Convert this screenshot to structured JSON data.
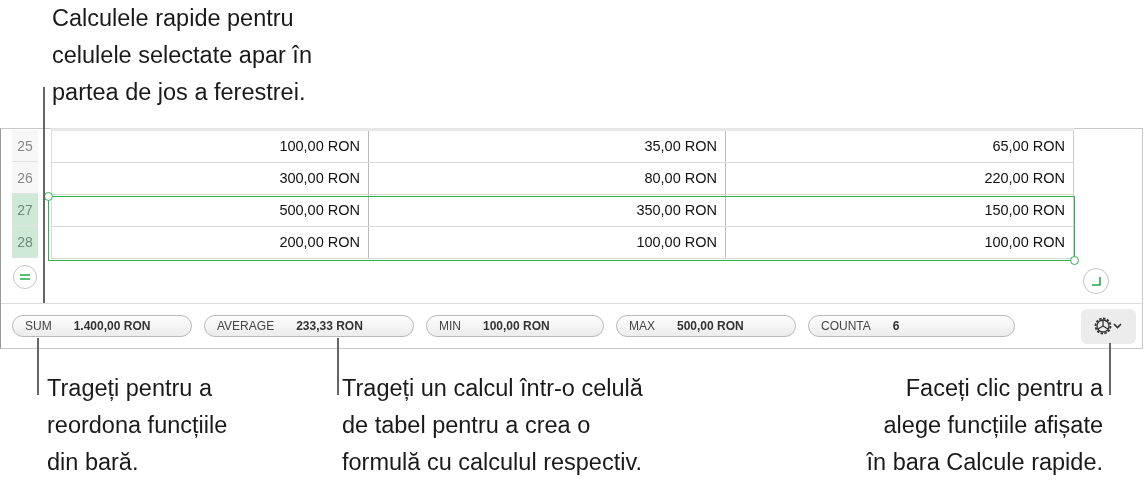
{
  "callouts": {
    "top": "Calculele rapide pentru\ncelulele selectate apar în\npartea de jos a ferestrei.",
    "bottom": [
      "Trageți pentru a\nreordona funcțiile\ndin bară.",
      "Trageți un calcul într-o celulă\nde tabel pentru a crea o\nformulă cu calculul respectiv.",
      "Faceți clic pentru a\nalege funcțiile afișate\nîn bara Calcule rapide."
    ]
  },
  "table": {
    "rows": [
      {
        "number": "25",
        "selected": false,
        "cells": [
          "100,00 RON",
          "35,00 RON",
          "65,00 RON"
        ]
      },
      {
        "number": "26",
        "selected": false,
        "cells": [
          "300,00 RON",
          "80,00 RON",
          "220,00 RON"
        ]
      },
      {
        "number": "27",
        "selected": true,
        "cells": [
          "500,00 RON",
          "350,00 RON",
          "150,00 RON"
        ]
      },
      {
        "number": "28",
        "selected": true,
        "cells": [
          "200,00 RON",
          "100,00 RON",
          "100,00 RON"
        ]
      }
    ]
  },
  "quick_calculations": [
    {
      "name": "SUM",
      "value": "1.400,00 RON"
    },
    {
      "name": "AVERAGE",
      "value": "233,33 RON"
    },
    {
      "name": "MIN",
      "value": "100,00 RON"
    },
    {
      "name": "MAX",
      "value": "500,00 RON"
    },
    {
      "name": "COUNTA",
      "value": "6"
    }
  ]
}
